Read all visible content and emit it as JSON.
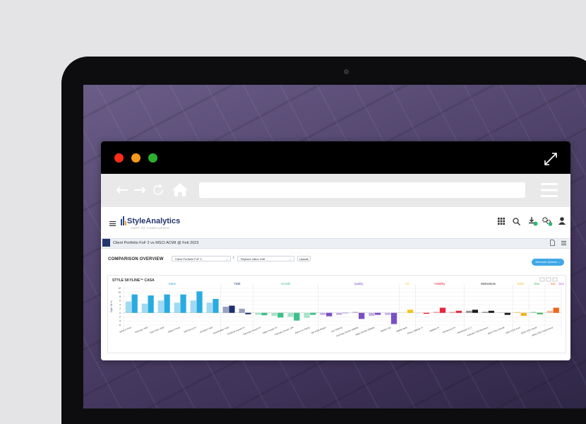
{
  "browser": {
    "url": "https://www.confluence.com",
    "icons": [
      "back-arrow-icon",
      "forward-arrow-icon",
      "reload-icon",
      "home-icon",
      "search-icon",
      "heart-icon",
      "hamburger-menu-icon"
    ]
  },
  "app": {
    "brand_name": "StyleAnalytics",
    "brand_sub": "PART OF CONFLUENCE",
    "breadcrumb": "Client Portfolio FoF 2 vs MSCI ACWI @ Feb 2023",
    "overview_title": "COMPARISON OVERVIEW",
    "portfolio_select": "Client Portfolio FoF 2",
    "separator": "/",
    "comparison_select": "Replace Value Drift",
    "update_label": "Update",
    "scenario_label": "Scenario Options",
    "panel_title": "STYLE SKYLINE™ CASA"
  },
  "colors": {
    "value": "#29abe2",
    "yield": "#1c2f6e",
    "growth": "#3cc08a",
    "quality": "#7b4fc4",
    "size": "#f5c518",
    "volatility": "#e8263b",
    "momentum": "#1a1a1a",
    "esg": "#f0b41e",
    "env": "#33b44a",
    "soc": "#f0641e",
    "gov": "#b44fe0"
  },
  "chart_data": {
    "type": "bar",
    "ylabel": "Style Tilt %",
    "ylim": [
      -6,
      12
    ],
    "yticks": [
      "12",
      "10",
      "8",
      "6",
      "4",
      "2",
      "0",
      "-2",
      "-4",
      "-6"
    ],
    "groups": [
      {
        "name": "Value",
        "color_key": "value",
        "start": 0,
        "end": 5
      },
      {
        "name": "Yield",
        "color_key": "yield",
        "start": 6,
        "end": 7
      },
      {
        "name": "Growth",
        "color_key": "growth",
        "start": 8,
        "end": 11
      },
      {
        "name": "Quality",
        "color_key": "quality",
        "start": 12,
        "end": 16
      },
      {
        "name": "Sz",
        "color_key": "size",
        "start": 17,
        "end": 17
      },
      {
        "name": "Volatility",
        "color_key": "volatility",
        "start": 18,
        "end": 20
      },
      {
        "name": "Momentum",
        "color_key": "momentum",
        "start": 21,
        "end": 23
      },
      {
        "name": "ESG",
        "color_key": "esg",
        "start": 24,
        "end": 24
      },
      {
        "name": "Env",
        "color_key": "env",
        "start": 25,
        "end": 25
      },
      {
        "name": "Soc",
        "color_key": "soc",
        "start": 26,
        "end": 26
      },
      {
        "name": "Gov",
        "color_key": "gov",
        "start": 27,
        "end": 27
      }
    ],
    "categories": [
      "Book to Price",
      "Earnings Yield",
      "Cash Flow Yield",
      "Sales to Price",
      "EBITDA to EV",
      "Dividend Yield",
      "Shareholder Yield",
      "Dividend Growth 5Y",
      "Earnings Growth 5Y",
      "Sales Growth 5Y",
      "Forecast Growth 12M",
      "Return on Equity",
      "Net Profit Margin",
      "Low Gearing",
      "Earnings Growth Stability",
      "Sales Growth Stability",
      "Market Cap",
      "Market Beta",
      "Share Volatility 1Y",
      "Volatility 3Y",
      "Momentum 3Y",
      "Momentum 12-1",
      "Forecast 12M Revisions",
      "MSCI ESG Overall",
      "MSCI ESG Envir",
      "MSCI ESG Social",
      "MSCI ESG Governance"
    ],
    "categories_note": "",
    "series_light": [
      5.5,
      4.5,
      6,
      5,
      6,
      5,
      3,
      2,
      -1,
      -1.5,
      -2,
      -2.5,
      -1,
      -1,
      0.5,
      -1.5,
      -1,
      0,
      0,
      0.5,
      0.5,
      1,
      0.5,
      0,
      0.5,
      0.5,
      1
    ],
    "series_dark": [
      9,
      8.5,
      9,
      9,
      10.5,
      6.8,
      3.5,
      -0.7,
      -1.2,
      -2.3,
      -3.8,
      -1,
      -1.7,
      -0.2,
      -3,
      -1,
      -5.5,
      1.5,
      -0.5,
      2.5,
      1,
      1.5,
      1,
      -1,
      -1.5,
      -0.7,
      2.5
    ]
  }
}
